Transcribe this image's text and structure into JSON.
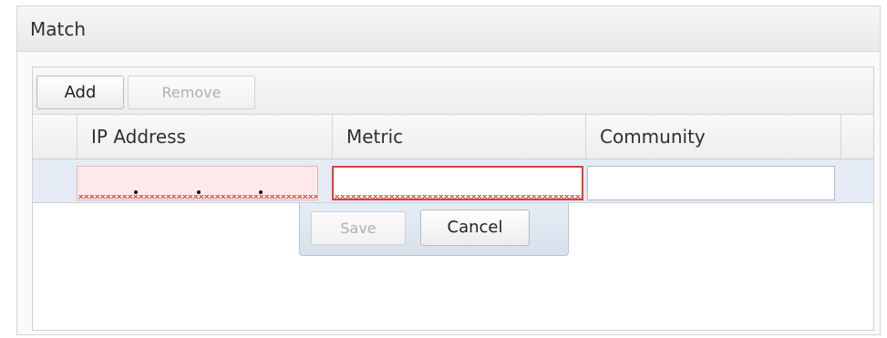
{
  "panel": {
    "title": "Match"
  },
  "toolbar": {
    "add_label": "Add",
    "remove_label": "Remove"
  },
  "grid": {
    "columns": [
      "IP Address",
      "Metric",
      "Community"
    ],
    "edit_row": {
      "ip_value": "",
      "metric_value": "",
      "community_value": ""
    }
  },
  "row_editor": {
    "save_label": "Save",
    "cancel_label": "Cancel"
  }
}
